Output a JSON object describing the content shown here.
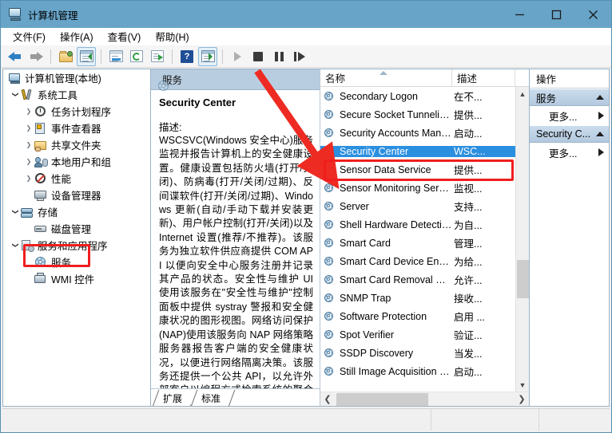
{
  "window": {
    "title": "计算机管理",
    "icon": "computer-management-icon",
    "minimize_label": "最小化",
    "maximize_label": "最大化",
    "close_label": "关闭"
  },
  "menu": {
    "items": [
      {
        "label": "文件(F)"
      },
      {
        "label": "操作(A)"
      },
      {
        "label": "查看(V)"
      },
      {
        "label": "帮助(H)"
      }
    ]
  },
  "toolbar": {
    "buttons": [
      {
        "name": "back-icon",
        "label": "后退"
      },
      {
        "name": "forward-icon",
        "label": "前进"
      },
      {
        "name": "up-folder-icon",
        "label": "向上"
      },
      {
        "name": "show-hide-tree-icon",
        "label": "显示/隐藏控制台树"
      },
      {
        "name": "properties-icon",
        "label": "属性"
      },
      {
        "name": "refresh-icon",
        "label": "刷新"
      },
      {
        "name": "export-list-icon",
        "label": "导出列表"
      },
      {
        "name": "help-icon",
        "label": "帮助"
      },
      {
        "name": "show-action-pane-icon",
        "label": "显示/隐藏操作窗格"
      },
      {
        "name": "start-service-icon",
        "label": "启动服务"
      },
      {
        "name": "stop-service-icon",
        "label": "停止服务"
      },
      {
        "name": "pause-service-icon",
        "label": "暂停服务"
      },
      {
        "name": "restart-service-icon",
        "label": "重启服务"
      }
    ]
  },
  "tree": {
    "items": [
      {
        "label": "计算机管理(本地)",
        "depth": 0,
        "twisty": "none",
        "icon": "computer-icon"
      },
      {
        "label": "系统工具",
        "depth": 1,
        "twisty": "expanded",
        "icon": "system-tools-icon"
      },
      {
        "label": "任务计划程序",
        "depth": 2,
        "twisty": "collapsed",
        "icon": "task-scheduler-icon"
      },
      {
        "label": "事件查看器",
        "depth": 2,
        "twisty": "collapsed",
        "icon": "event-viewer-icon"
      },
      {
        "label": "共享文件夹",
        "depth": 2,
        "twisty": "collapsed",
        "icon": "shared-folders-icon"
      },
      {
        "label": "本地用户和组",
        "depth": 2,
        "twisty": "collapsed",
        "icon": "local-users-groups-icon"
      },
      {
        "label": "性能",
        "depth": 2,
        "twisty": "collapsed",
        "icon": "performance-icon"
      },
      {
        "label": "设备管理器",
        "depth": 2,
        "twisty": "none",
        "icon": "device-manager-icon"
      },
      {
        "label": "存储",
        "depth": 1,
        "twisty": "expanded",
        "icon": "storage-icon"
      },
      {
        "label": "磁盘管理",
        "depth": 2,
        "twisty": "none",
        "icon": "disk-management-icon"
      },
      {
        "label": "服务和应用程序",
        "depth": 1,
        "twisty": "expanded",
        "icon": "services-applications-icon"
      },
      {
        "label": "服务",
        "depth": 2,
        "twisty": "none",
        "icon": "services-gear-icon",
        "highlighted": true
      },
      {
        "label": "WMI 控件",
        "depth": 2,
        "twisty": "none",
        "icon": "wmi-control-icon"
      }
    ]
  },
  "details": {
    "header": "服务",
    "header_icon": "services-gear-icon",
    "service_name": "Security Center",
    "description_label": "描述:",
    "description": "WSCSVC(Windows 安全中心)服务监视并报告计算机上的安全健康设置。健康设置包括防火墙(打开/关闭)、防病毒(打开/关闭/过期)、反间谍软件(打开/关闭/过期)、Windows 更新(自动/手动下载并安装更新)、用户帐户控制(打开/关闭)以及 Internet 设置(推荐/不推荐)。该服务为独立软件供应商提供 COM API 以便向安全中心服务注册并记录其产品的状态。安全性与维护 UI 使用该服务在\"安全性与维护\"控制面板中提供 systray 警报和安全健康状况的图形视图。网络访问保护(NAP)使用该服务向 NAP 网络策略服务器报告客户端的安全健康状况，以便进行网络隔离决策。该服务还提供一个公共 API，以允许外部客户以编程方式检索系统的聚合安全健康状况。",
    "tabs": [
      {
        "label": "扩展",
        "selected": false
      },
      {
        "label": "标准",
        "selected": true
      }
    ]
  },
  "list": {
    "columns": [
      {
        "label": "名称",
        "sorted": "ascending"
      },
      {
        "label": "描述"
      }
    ],
    "rows": [
      {
        "name": "Secondary Logon",
        "desc": "在不..."
      },
      {
        "name": "Secure Socket Tunneling ...",
        "desc": "提供..."
      },
      {
        "name": "Security Accounts Manag...",
        "desc": "启动..."
      },
      {
        "name": "Security Center",
        "desc": "WSC...",
        "selected": true
      },
      {
        "name": "Sensor Data Service",
        "desc": "提供..."
      },
      {
        "name": "Sensor Monitoring Service",
        "desc": "监视..."
      },
      {
        "name": "Server",
        "desc": "支持..."
      },
      {
        "name": "Shell Hardware Detection",
        "desc": "为自..."
      },
      {
        "name": "Smart Card",
        "desc": "管理..."
      },
      {
        "name": "Smart Card Device Enum...",
        "desc": "为给..."
      },
      {
        "name": "Smart Card Removal Poli...",
        "desc": "允许..."
      },
      {
        "name": "SNMP Trap",
        "desc": "接收..."
      },
      {
        "name": "Software Protection",
        "desc": "启用 ..."
      },
      {
        "name": "Spot Verifier",
        "desc": "验证..."
      },
      {
        "name": "SSDP Discovery",
        "desc": "当发..."
      },
      {
        "name": "Still Image Acquisition Ev...",
        "desc": "启动..."
      }
    ],
    "row_icon": "service-gear-icon",
    "scroll_up_label": "向上滚动",
    "scroll_down_label": "向下滚动",
    "scroll_left_label": "向左滚动",
    "scroll_right_label": "向右滚动"
  },
  "actions": {
    "title": "操作",
    "groups": [
      {
        "name": "服务",
        "item": "更多..."
      },
      {
        "name": "Security C...",
        "item": "更多..."
      }
    ]
  },
  "annotations": {
    "arrow_color": "#ee2b22",
    "box_color": "#f01e1e",
    "arrow_from": "服务树节点",
    "arrow_to": "Security Center 列表项"
  }
}
